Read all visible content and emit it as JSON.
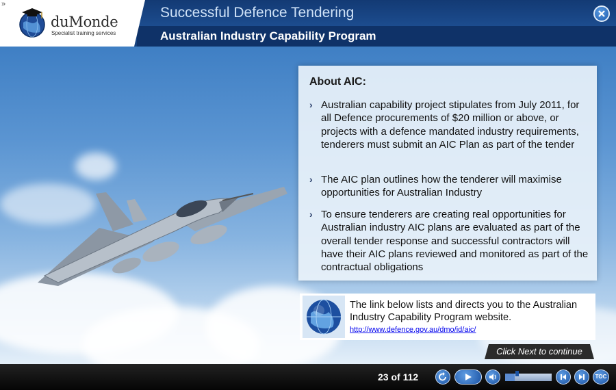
{
  "header": {
    "brand_name": "duMonde",
    "brand_tagline": "Specialist training services",
    "course_title": "Successful Defence Tendering",
    "module_title": "Australian Industry Capability Program",
    "expand_glyph": "»"
  },
  "about": {
    "heading": "About AIC:",
    "bullets": [
      {
        "text": "Australian capability project stipulates from July 2011, for all Defence procurements of $20 million or above, or projects with a defence mandated industry requirements, tenderers must submit an AIC Plan as part of the tender"
      },
      {
        "text": "The AIC plan outlines how the tenderer will maximise opportunities for Australian Industry"
      },
      {
        "text": "To ensure tenderers are creating real opportunities for Australian industry AIC plans are evaluated as part of the overall tender response and successful contractors will have their AIC plans reviewed and monitored as part of the contractual obligations"
      }
    ]
  },
  "link_card": {
    "text": "The link below lists and directs you to the Australian Industry Capability Program website.",
    "url": "http://www.defence.gov.au/dmo/id/aic/"
  },
  "callout": {
    "next_text": "Click Next to continue"
  },
  "player": {
    "page_counter": "23 of 112",
    "progress_fraction": 0.21,
    "toc_label": "TOC",
    "icons": [
      "replay-icon",
      "play-icon",
      "volume-icon",
      "previous-icon",
      "next-icon",
      "toc-icon",
      "close-icon"
    ]
  },
  "colors": {
    "header_bg": "#1c4c8e",
    "accent_button": "#1b53a4",
    "card_bg": "#e9f2fa",
    "link": "#0000ee"
  }
}
